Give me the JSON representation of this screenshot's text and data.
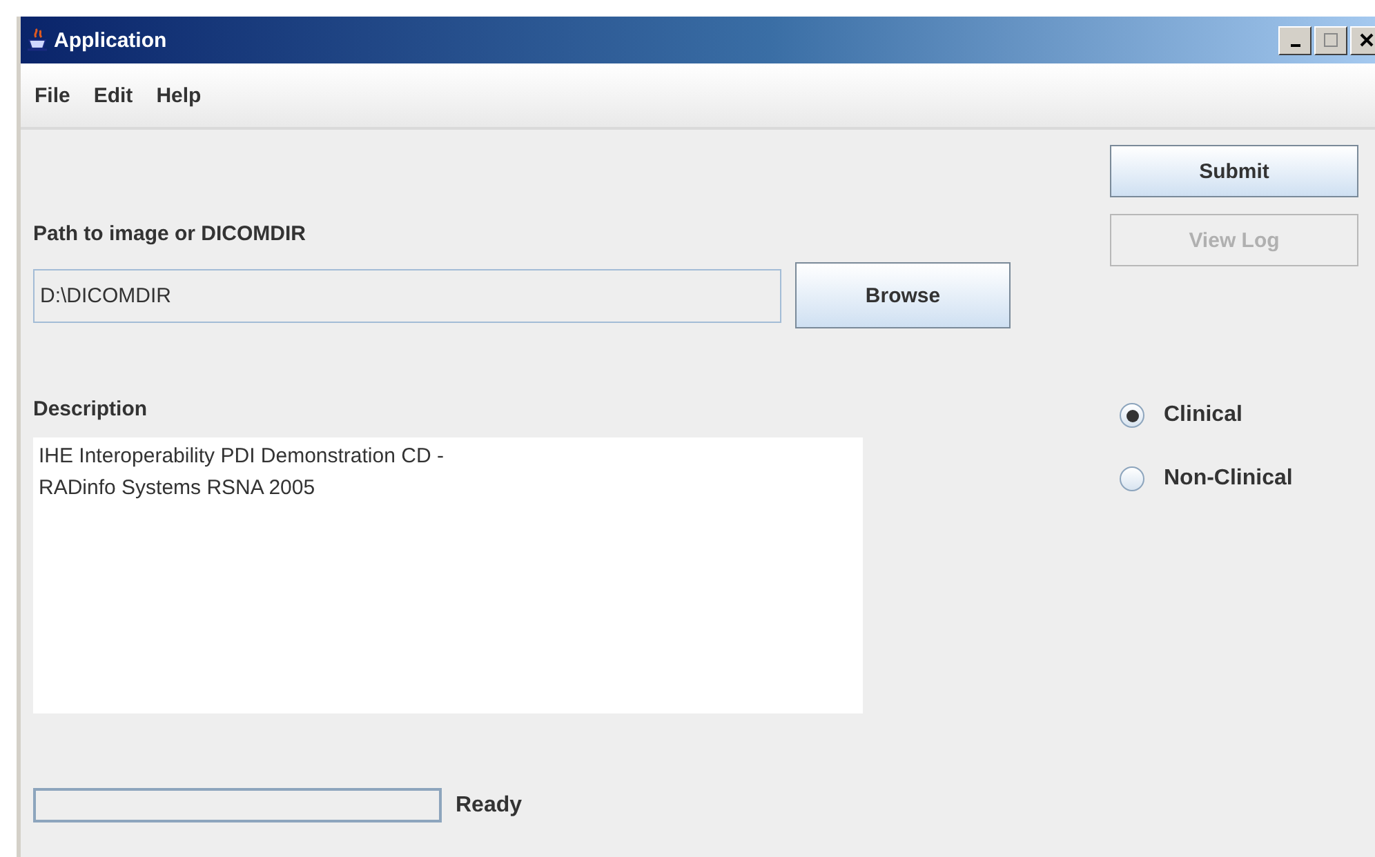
{
  "window": {
    "title": "Application"
  },
  "menu": [
    "File",
    "Edit",
    "Help"
  ],
  "path": {
    "label": "Path to image or DICOMDIR",
    "value": "D:\\DICOMDIR",
    "browse": "Browse"
  },
  "description": {
    "label": "Description",
    "value": "IHE Interoperability PDI Demonstration CD -\nRADinfo Systems RSNA 2005"
  },
  "buttons": [
    {
      "label": "Submit",
      "disabled": false
    },
    {
      "label": "View Log",
      "disabled": true
    }
  ],
  "options": [
    {
      "label": "Clinical",
      "selected": true
    },
    {
      "label": "Non-Clinical",
      "selected": false
    }
  ],
  "status": {
    "level": 0,
    "text": "Ready"
  }
}
